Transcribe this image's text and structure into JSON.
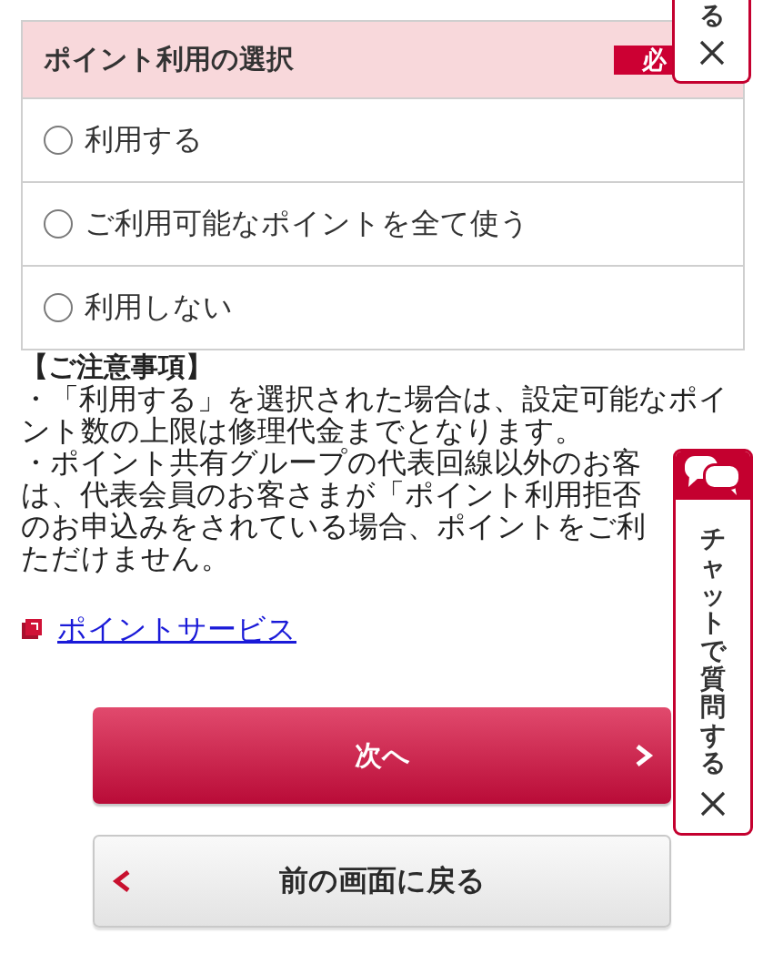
{
  "top_chat_widget": {
    "label": "る"
  },
  "point_usage": {
    "title": "ポイント利用の選択",
    "badge": "必",
    "options": [
      {
        "label": "利用する",
        "selected": false
      },
      {
        "label": "ご利用可能なポイントを全て使う",
        "selected": false
      },
      {
        "label": "利用しない",
        "selected": false
      }
    ]
  },
  "notes": {
    "heading": "【ご注意事項】",
    "items": [
      {
        "lines": [
          "・「利用する」を選択された場合は、設定可能なポイント数の上限は修理代金までとなります。"
        ]
      },
      {
        "lines": [
          "・ポイント共有グループの代表回線以外のお客",
          "は、代表会員のお客さまが「ポイント利用拒否",
          "のお申込みをされている場合、ポイントをご利",
          "ただけません。"
        ]
      }
    ]
  },
  "link": {
    "label": "ポイントサービス"
  },
  "buttons": [
    {
      "label": "次へ",
      "kind": "primary"
    },
    {
      "label": "前の画面に戻る",
      "kind": "secondary"
    }
  ],
  "chat_widget": {
    "label": "チャットで質問する"
  }
}
